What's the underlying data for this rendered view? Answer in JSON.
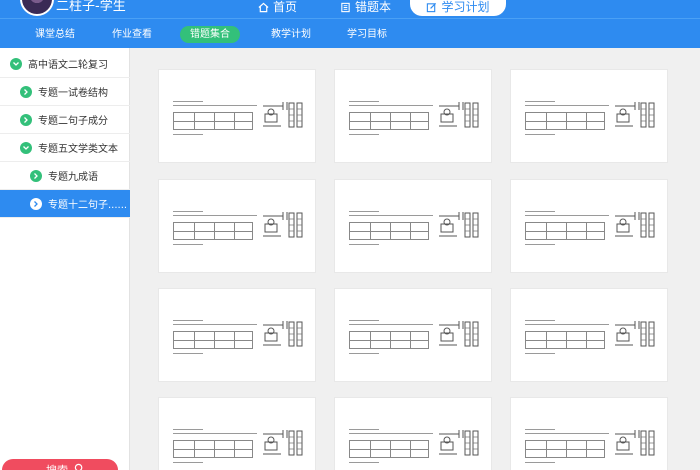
{
  "header": {
    "username": "二柱子-学生",
    "nav": [
      {
        "label": "首页",
        "icon": "home-icon"
      },
      {
        "label": "错题本",
        "icon": "book-icon"
      },
      {
        "label": "学习计划",
        "icon": "edit-icon",
        "active": true
      }
    ]
  },
  "subnav": {
    "items": [
      {
        "label": "课堂总结"
      },
      {
        "label": "作业查看"
      },
      {
        "label": "错题集合",
        "active": true
      },
      {
        "label": "教学计划"
      },
      {
        "label": "学习目标"
      }
    ]
  },
  "sidebar": {
    "items": [
      {
        "label": "高中语文二轮复习",
        "icon": "chevron-down-icon"
      },
      {
        "label": "专题一试卷结构",
        "icon": "chevron-right-icon"
      },
      {
        "label": "专题二句子成分",
        "icon": "chevron-right-icon"
      },
      {
        "label": "专题五文学类文本",
        "icon": "chevron-down-icon"
      },
      {
        "label": "专题九成语",
        "icon": "chevron-right-icon"
      },
      {
        "label": "专题十二句子......",
        "icon": "chevron-right-icon",
        "selected": true
      }
    ],
    "search_label": "搜索"
  },
  "colors": {
    "primary": "#2e8bf0",
    "accent_green": "#33c07a",
    "search_red": "#f04c5f"
  }
}
